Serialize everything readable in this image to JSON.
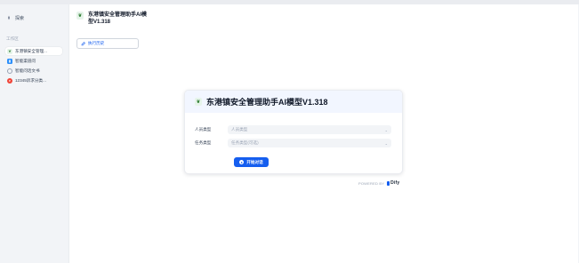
{
  "sidebar": {
    "explore_label": "探索",
    "section_label": "工作区",
    "items": [
      {
        "label": "东港镇安全管理...",
        "icon": "app-leaf-icon",
        "icon_color": "#e6f4ea",
        "active": true
      },
      {
        "label": "智能渠道问",
        "icon": "book-icon",
        "icon_color": "#2e90fa",
        "active": false
      },
      {
        "label": "智能问话文书",
        "icon": "chat-bubble-icon",
        "icon_color": "#98a2b3",
        "active": false
      },
      {
        "label": "12345诉求分类...",
        "icon": "red-circle-icon",
        "icon_color": "#f04438",
        "active": false
      }
    ]
  },
  "header": {
    "app_title": "东港镇安全管理助手AI模型V1.318",
    "history_label": "执行历史"
  },
  "form": {
    "title": "东港镇安全管理助手AI模型V1.318",
    "fields": [
      {
        "label": "人员类型",
        "placeholder": "人员类型"
      },
      {
        "label": "任务类型",
        "placeholder": "任务类型(可选)"
      }
    ],
    "start_label": "开始对话"
  },
  "footer": {
    "powered_by": "POWERED BY",
    "brand": "Dify"
  },
  "colors": {
    "accent": "#155eef",
    "card_header": "#f2f6ff"
  }
}
